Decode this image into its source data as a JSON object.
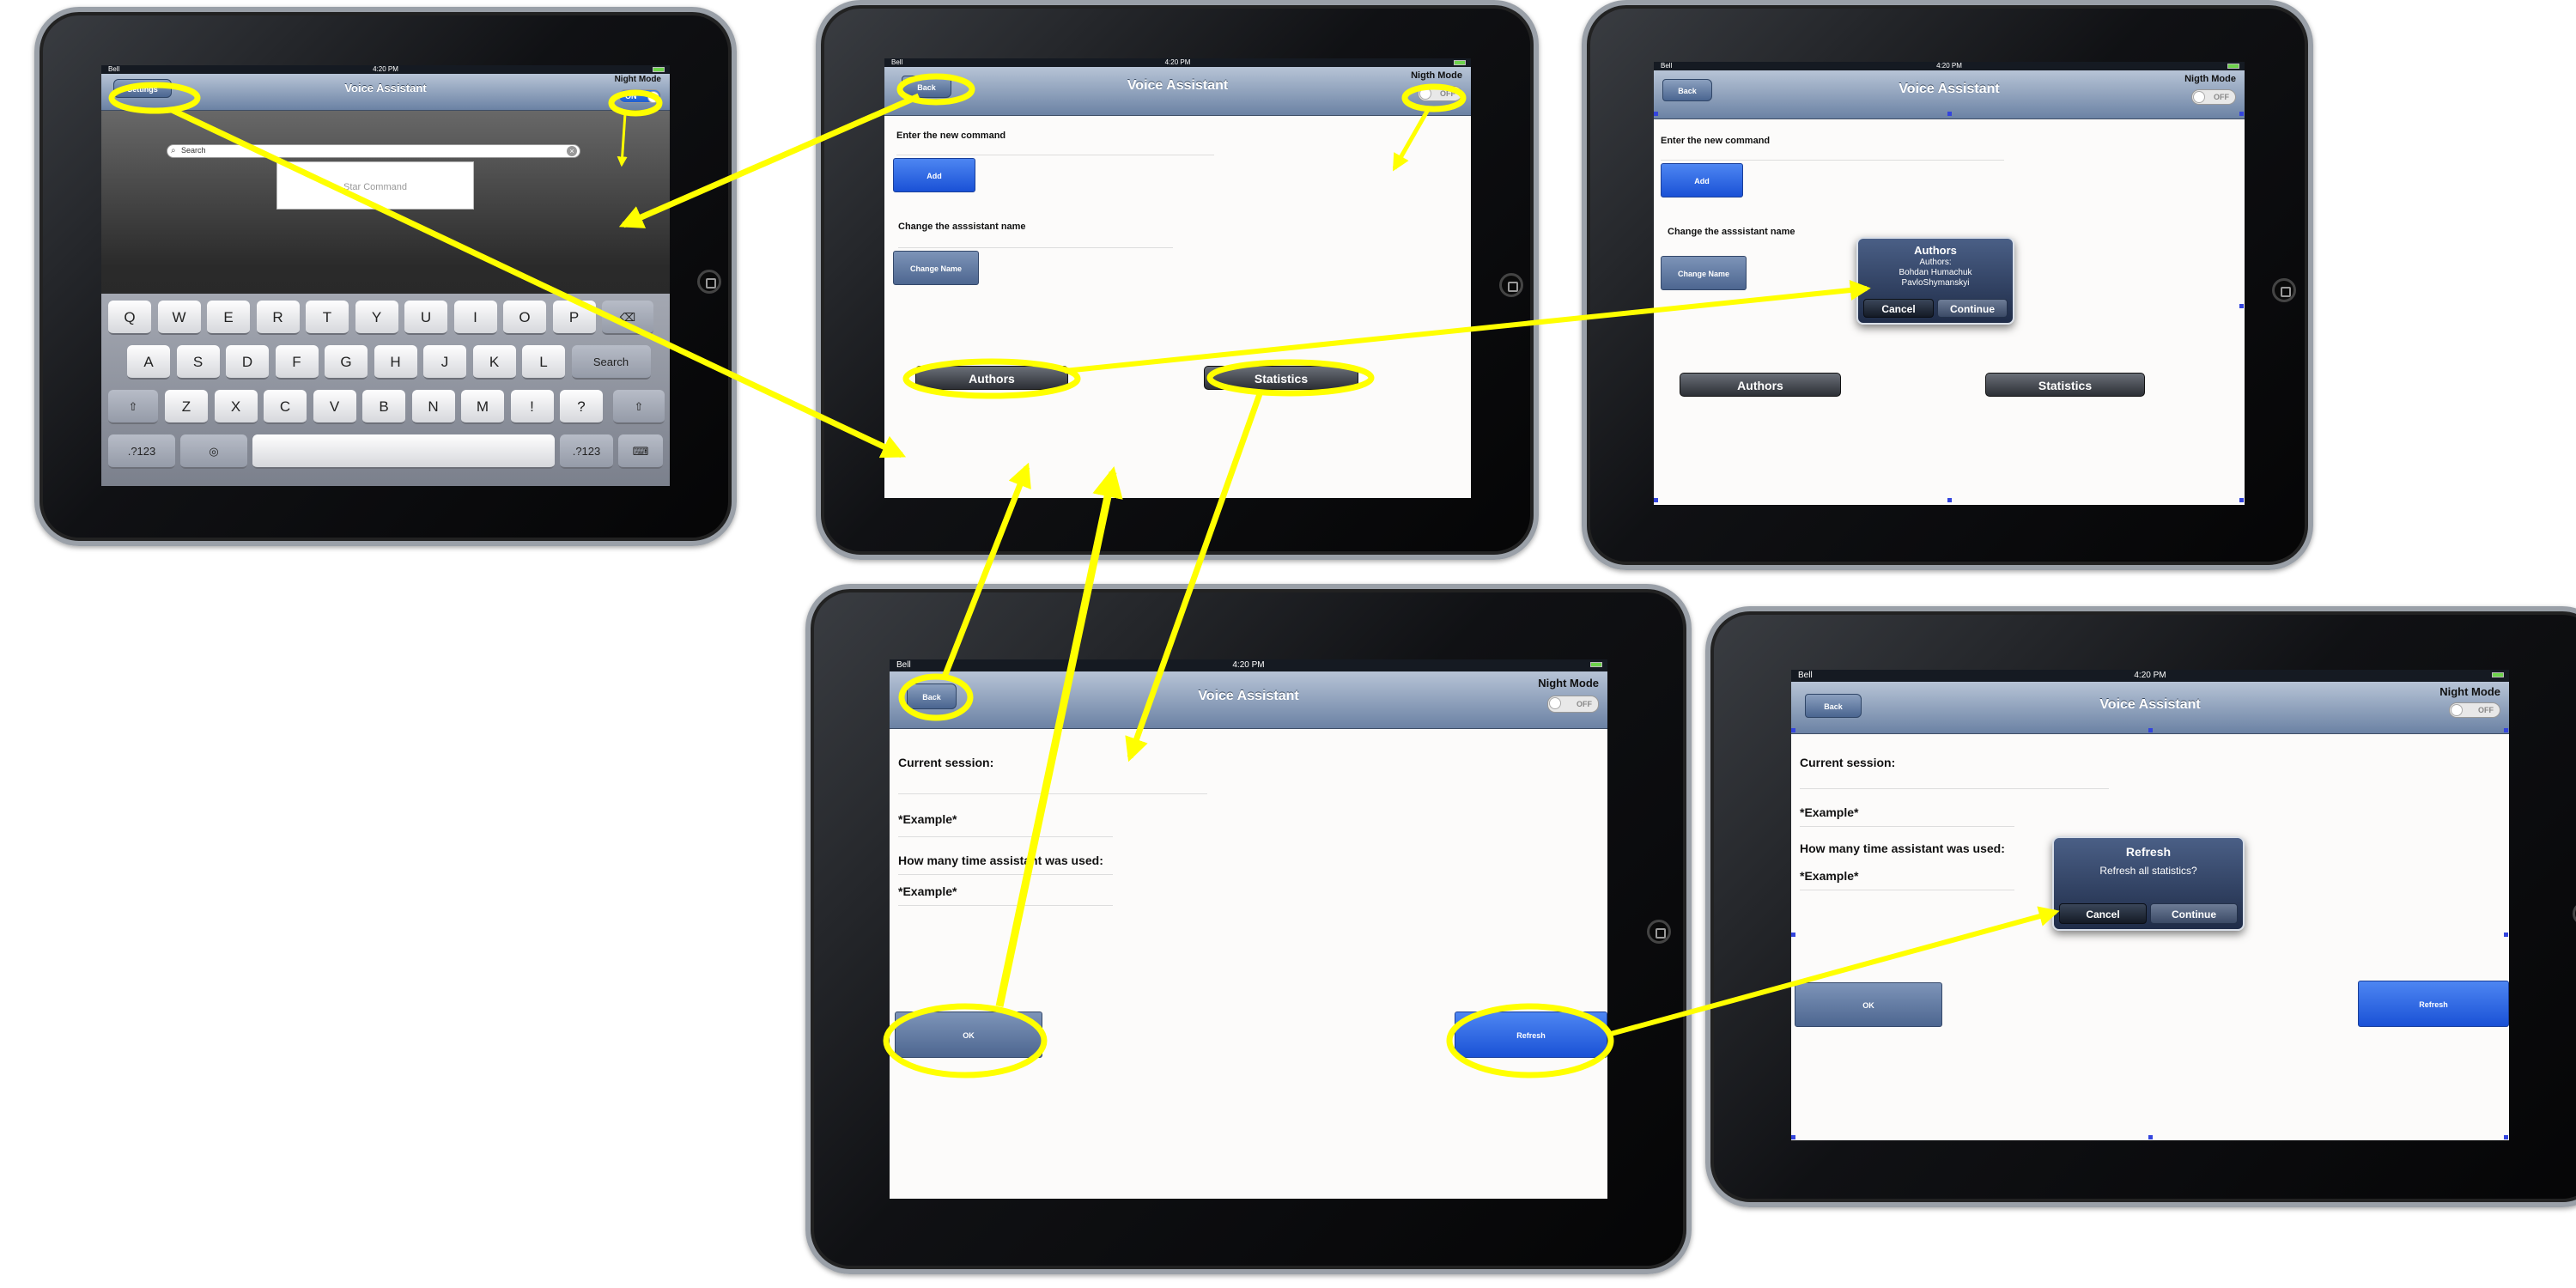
{
  "colors": {
    "highlight": "#ffff00",
    "nav_gradient_top": "#b7c4d6",
    "nav_gradient_bottom": "#6b82a4",
    "button_blue": "#1a51d6"
  },
  "status_bar": {
    "carrier": "Bell",
    "time": "4:20 PM"
  },
  "screen_main": {
    "settings_label": "Settings",
    "title": "Voice Assistant",
    "night_mode_label": "Night Mode",
    "toggle_on": "ON",
    "search_placeholder": "Search",
    "star_command": "Star Command",
    "keyboard": {
      "row1": [
        "Q",
        "W",
        "E",
        "R",
        "T",
        "Y",
        "U",
        "I",
        "O",
        "P"
      ],
      "row2": [
        "A",
        "S",
        "D",
        "F",
        "G",
        "H",
        "J",
        "K",
        "L"
      ],
      "search_key": "Search",
      "row3": [
        "Z",
        "X",
        "C",
        "V",
        "B",
        "N",
        "M",
        "!",
        ",",
        "?",
        "."
      ],
      "numbers_key": ".?123"
    }
  },
  "screen_settings": {
    "back_label": "Back",
    "title": "Voice Assistant",
    "night_mode_label": "Nigth Mode",
    "toggle_off": "OFF",
    "enter_command_label": "Enter the new command",
    "add_button": "Add",
    "change_name_label": "Change the asssistant name",
    "change_name_button": "Change Name",
    "authors_button": "Authors",
    "statistics_button": "Statistics"
  },
  "screen_authors_alert": {
    "title": "Authors",
    "line1": "Authors:",
    "line2": "Bohdan Humachuk",
    "line3": "PavloShymanskyi",
    "cancel": "Cancel",
    "continue": "Continue"
  },
  "screen_stats": {
    "back_label": "Back",
    "title": "Voice Assistant",
    "night_mode_label": "Night Mode",
    "toggle_off": "OFF",
    "current_session_label": "Current session:",
    "example_1": "*Example*",
    "usage_label": "How many time assistant was used:",
    "example_2": "*Example*",
    "ok_button": "OK",
    "refresh_button": "Refresh"
  },
  "screen_refresh_alert": {
    "title": "Refresh",
    "message": "Refresh all statistics?",
    "cancel": "Cancel",
    "continue": "Continue"
  }
}
